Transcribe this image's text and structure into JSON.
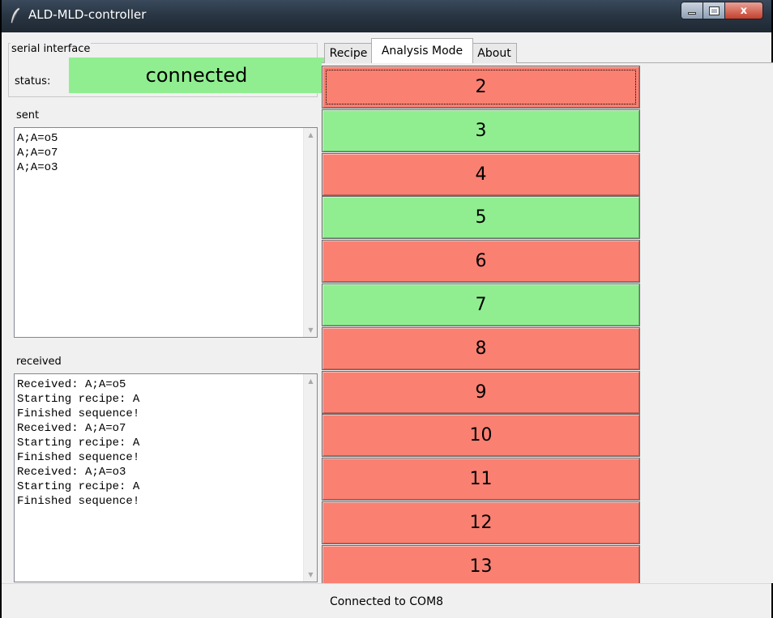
{
  "window": {
    "title": "ALD-MLD-controller",
    "close_glyph": "x"
  },
  "serial": {
    "legend": "serial interface",
    "status_label": "status:",
    "status_value": "connected",
    "status_color": "#90ee90"
  },
  "sent": {
    "label": "sent",
    "text": "A;A=o5\nA;A=o7\nA;A=o3"
  },
  "received": {
    "label": "received",
    "text": "Received: A;A=o5\nStarting recipe: A\nFinished sequence!\nReceived: A;A=o7\nStarting recipe: A\nFinished sequence!\nReceived: A;A=o3\nStarting recipe: A\nFinished sequence!"
  },
  "tabs": [
    {
      "label": "Recipe",
      "active": false
    },
    {
      "label": "Analysis Mode",
      "active": true
    },
    {
      "label": "About",
      "active": false
    }
  ],
  "colors": {
    "on": "#90ee90",
    "off": "#fa8072"
  },
  "steps": [
    {
      "label": "2",
      "state": "off",
      "focused": true
    },
    {
      "label": "3",
      "state": "on"
    },
    {
      "label": "4",
      "state": "off"
    },
    {
      "label": "5",
      "state": "on"
    },
    {
      "label": "6",
      "state": "off"
    },
    {
      "label": "7",
      "state": "on"
    },
    {
      "label": "8",
      "state": "off"
    },
    {
      "label": "9",
      "state": "off"
    },
    {
      "label": "10",
      "state": "off"
    },
    {
      "label": "11",
      "state": "off"
    },
    {
      "label": "12",
      "state": "off"
    },
    {
      "label": "13",
      "state": "off"
    }
  ],
  "statusbar": {
    "text": "Connected to COM8"
  },
  "icons": {
    "app": "feather-icon",
    "minimize": "minimize-icon",
    "maximize": "maximize-icon",
    "close": "close-icon",
    "scroll_up": "chevron-up-icon",
    "scroll_down": "chevron-down-icon"
  }
}
